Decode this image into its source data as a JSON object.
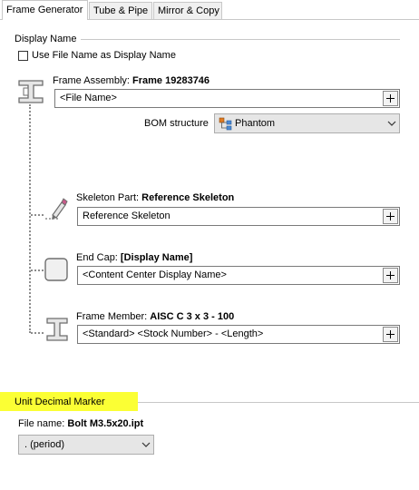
{
  "tabs": [
    {
      "label": "Frame Generator",
      "active": true
    },
    {
      "label": "Tube & Pipe",
      "active": false
    },
    {
      "label": "Mirror & Copy",
      "active": false
    }
  ],
  "display_name": {
    "header": "Display Name",
    "checkbox_label": "Use File Name as Display Name",
    "checked": false
  },
  "frame_assembly": {
    "label": "Frame Assembly: ",
    "value": "Frame 19283746",
    "field_text": "<File Name>",
    "bom_label": "BOM structure",
    "bom_value": "Phantom"
  },
  "skeleton_part": {
    "label": "Skeleton Part: ",
    "value": "Reference Skeleton",
    "field_text": "Reference Skeleton"
  },
  "end_cap": {
    "label": "End Cap: ",
    "value": "[Display Name]",
    "field_text": "<Content Center Display Name>"
  },
  "frame_member": {
    "label": "Frame Member: ",
    "value": "AISC C 3 x 3 - 100",
    "field_text": "<Standard> <Stock Number> - <Length>"
  },
  "unit_decimal": {
    "header": "Unit Decimal Marker",
    "file_label": "File name: ",
    "file_value": "Bolt M3.5x20.ipt",
    "select_value": ". (period)",
    "highlight_color": "#fbff34"
  },
  "icons": [
    "frame-assembly-icon",
    "skeleton-part-icon",
    "end-cap-icon",
    "frame-member-icon",
    "phantom-bom-icon",
    "chevron-down-icon",
    "plus-icon"
  ]
}
